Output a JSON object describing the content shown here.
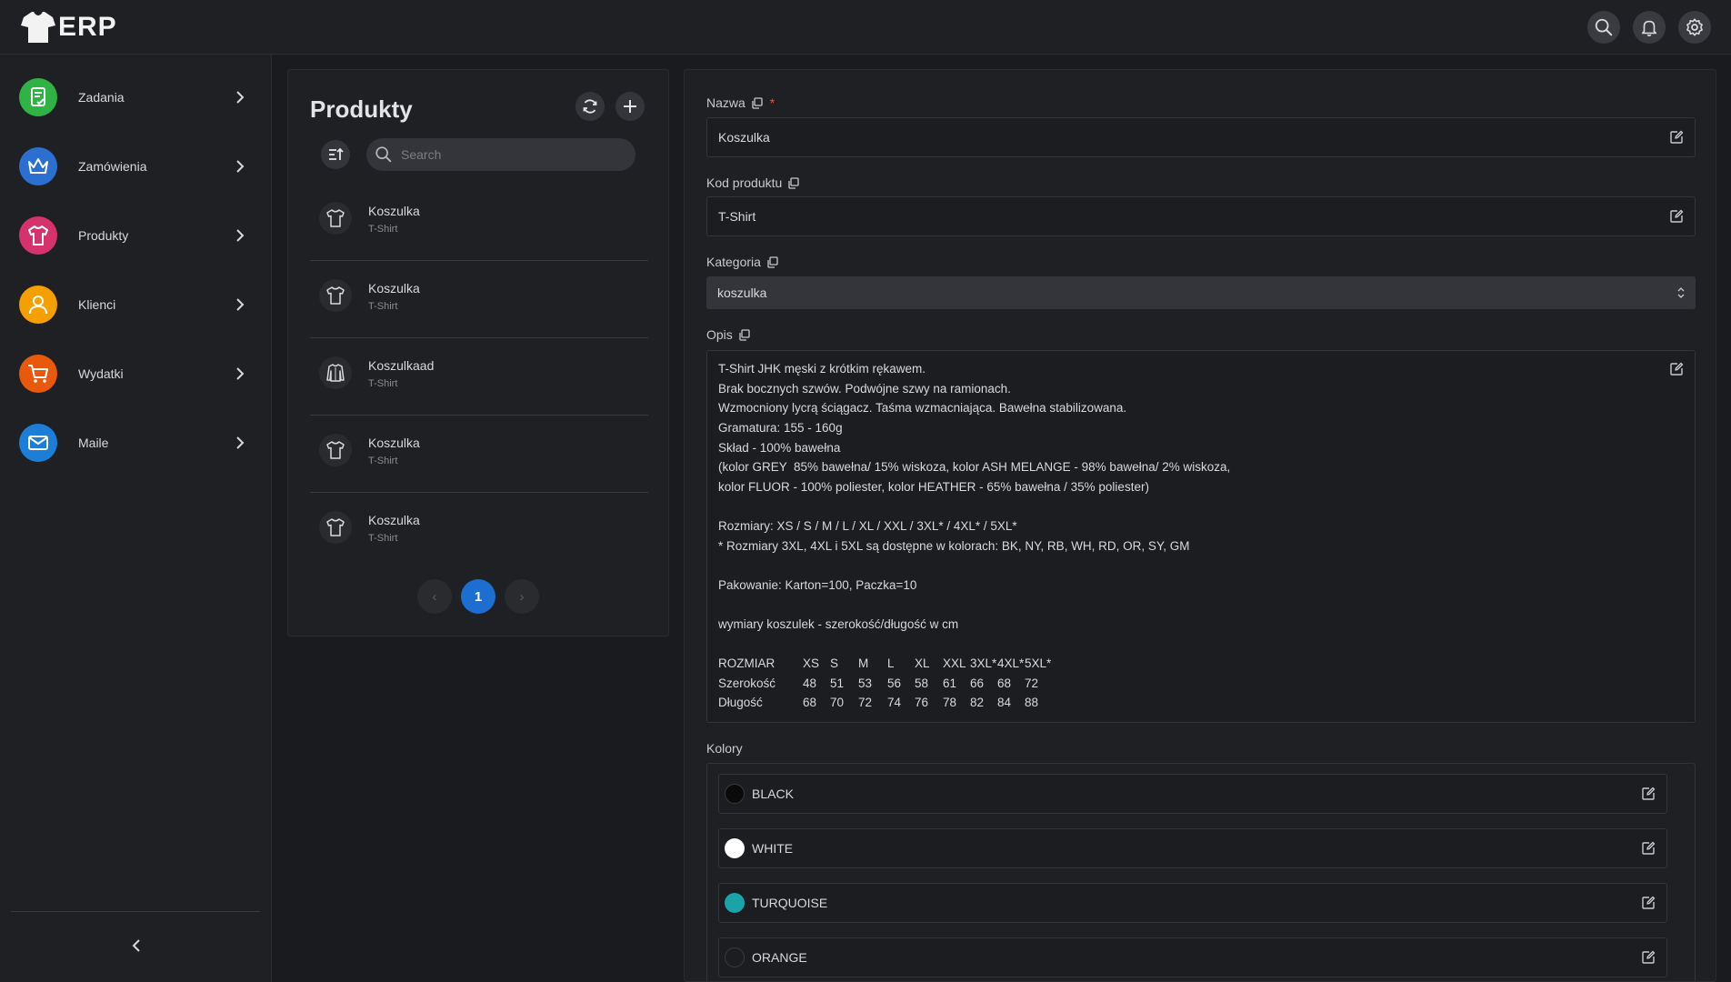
{
  "app": {
    "name": "ERP"
  },
  "sidebar": {
    "items": [
      {
        "label": "Zadania",
        "icon": "tasks-icon",
        "color": "#2fb344"
      },
      {
        "label": "Zamówienia",
        "icon": "crown-icon",
        "color": "#2b6fd1"
      },
      {
        "label": "Produkty",
        "icon": "tshirt-icon",
        "color": "#d6336c"
      },
      {
        "label": "Klienci",
        "icon": "user-icon",
        "color": "#f59f00"
      },
      {
        "label": "Wydatki",
        "icon": "cart-icon",
        "color": "#e8590c"
      },
      {
        "label": "Maile",
        "icon": "mail-icon",
        "color": "#1c7ed6"
      }
    ]
  },
  "products": {
    "title": "Produkty",
    "search_placeholder": "Search",
    "items": [
      {
        "name": "Koszulka",
        "code": "T-Shirt",
        "icon": "tshirt-icon"
      },
      {
        "name": "Koszulka",
        "code": "T-Shirt",
        "icon": "tshirt-icon"
      },
      {
        "name": "Koszulkaad",
        "code": "T-Shirt",
        "icon": "sweater-icon"
      },
      {
        "name": "Koszulka",
        "code": "T-Shirt",
        "icon": "tshirt-icon"
      },
      {
        "name": "Koszulka",
        "code": "T-Shirt",
        "icon": "tshirt-icon"
      }
    ],
    "pagination": {
      "prev": "‹",
      "current": "1",
      "next": "›"
    }
  },
  "detail": {
    "name_label": "Nazwa",
    "required_mark": "*",
    "name_value": "Koszulka",
    "code_label": "Kod produktu",
    "code_value": "T-Shirt",
    "category_label": "Kategoria",
    "category_value": "koszulka",
    "description_label": "Opis",
    "description_lines": [
      "T-Shirt JHK męski z krótkim rękawem.",
      "Brak bocznych szwów. Podwójne szwy na ramionach.",
      "Wzmocniony lycrą ściągacz. Taśma wzmacniająca. Bawełna stabilizowana.",
      "Gramatura: 155 - 160g",
      "Skład - 100% bawełna",
      "(kolor GREY  85% bawełna/ 15% wiskoza, kolor ASH MELANGE - 98% bawełna/ 2% wiskoza,",
      "kolor FLUOR - 100% poliester, kolor HEATHER - 65% bawełna / 35% poliester)",
      "",
      "Rozmiary: XS / S / M / L / XL / XXL / 3XL* / 4XL* / 5XL*",
      "* Rozmiary 3XL, 4XL i 5XL są dostępne w kolorach: BK, NY, RB, WH, RD, OR, SY, GM",
      "",
      "Pakowanie: Karton=100, Paczka=10",
      "",
      "wymiary koszulek - szerokość/długość w cm"
    ],
    "size_table": {
      "rows": [
        {
          "label": "ROZMIAR",
          "cells": [
            "XS",
            "S",
            "M",
            "L",
            "XL",
            "XXL",
            "3XL*",
            "4XL*",
            "5XL*"
          ]
        },
        {
          "label": "Szerokość",
          "cells": [
            "48",
            "51",
            "53",
            "56",
            "58",
            "61",
            "66",
            "68",
            "72"
          ]
        },
        {
          "label": "Długość",
          "cells": [
            "68",
            "70",
            "72",
            "74",
            "76",
            "78",
            "82",
            "84",
            "88"
          ]
        }
      ]
    },
    "colors_label": "Kolory",
    "colors": [
      {
        "name": "BLACK",
        "hex": "#0a0a0a"
      },
      {
        "name": "WHITE",
        "hex": "#ffffff"
      },
      {
        "name": "TURQUOISE",
        "hex": "#1aa3a8"
      },
      {
        "name": "ORANGE",
        "hex": "#1c1d20"
      }
    ]
  }
}
